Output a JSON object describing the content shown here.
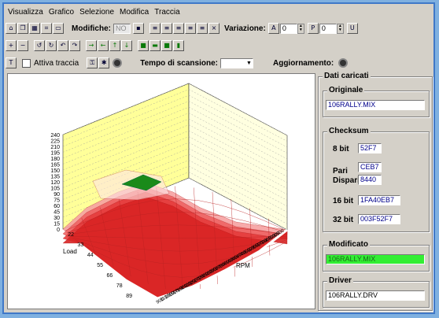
{
  "menu": [
    "Visualizza",
    "Grafico",
    "Selezione",
    "Modifica",
    "Traccia"
  ],
  "toolbar1": {
    "modifiche_label": "Modifiche:",
    "modifiche_value": "NO",
    "variazione_label": "Variazione:",
    "variazione_a_label": "A",
    "variazione_a_value": "0",
    "variazione_p_label": "P",
    "variazione_p_value": "0",
    "variazione_u_label": "U"
  },
  "toolbar3": {
    "attiva_traccia_label": "Attiva traccia",
    "tempo_label": "Tempo di scansione:",
    "aggiornamento_label": "Aggiornamento:"
  },
  "panel": {
    "dati_caricati": "Dati caricati",
    "originale_label": "Originale",
    "originale_value": "106RALLY.MIX",
    "checksum_label": "Checksum",
    "c8_label": "8 bit",
    "c8_value": "52F7",
    "pari_label": "Pari",
    "pari_value": "CEB7",
    "dispari_label": "Dispari",
    "dispari_value": "8440",
    "c16_label": "16 bit",
    "c16_value": "1FA40EB7",
    "c32_label": "32 bit",
    "c32_value": "003F52F7",
    "modificato_label": "Modificato",
    "modificato_value": "106RALLY.MIX",
    "driver_label": "Driver",
    "driver_value": "106RALLY.DRV"
  },
  "chart_data": {
    "type": "surface3d",
    "z_ticks": [
      "240",
      "225",
      "210",
      "195",
      "180",
      "165",
      "150",
      "135",
      "120",
      "105",
      "90",
      "75",
      "60",
      "45",
      "30",
      "15",
      "0"
    ],
    "rpm_label": "RPM",
    "load_label": "Load",
    "rpm_ticks": [
      "900",
      "1100",
      "1300",
      "1500",
      "1700",
      "1900",
      "2100",
      "2300",
      "2500",
      "2700",
      "2900",
      "3100",
      "3300",
      "3500",
      "3700",
      "3900",
      "4100",
      "4300",
      "4500",
      "4700",
      "4900",
      "5100",
      "5300",
      "5500",
      "5700",
      "5900",
      "6100",
      "6300",
      "6500"
    ],
    "load_ticks": [
      "22",
      "33",
      "44",
      "55",
      "66",
      "78",
      "89"
    ],
    "colors": {
      "wall_back": "#ffff99",
      "wall_side": "#ffffe0",
      "surface": "#ee3333",
      "peak": "#1a8a1a",
      "selection_highlight": "#33ee33"
    }
  }
}
